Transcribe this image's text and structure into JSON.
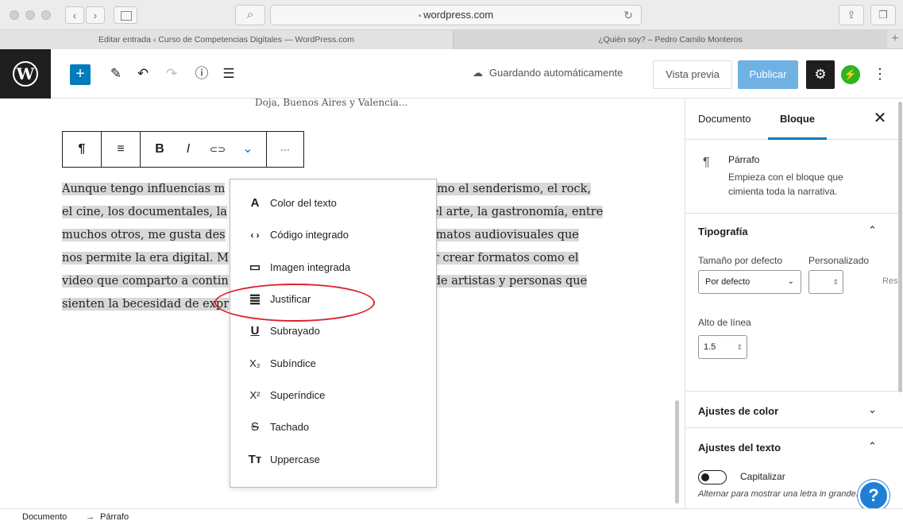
{
  "browser": {
    "url": "wordpress.com",
    "lock_icon": "lock-icon",
    "tabs": [
      {
        "title": "Editar entrada ‹ Curso de Competencias Digitales — WordPress.com",
        "active": true
      },
      {
        "title": "¿Quién soy? – Pedro Camilo Monteros",
        "active": false
      }
    ],
    "back_label": "‹",
    "forward_label": "›",
    "new_tab_label": "+"
  },
  "header": {
    "logo": "W",
    "add_block_label": "+",
    "saving_text": "Guardando automáticamente",
    "preview_label": "Vista previa",
    "publish_label": "Publicar",
    "more_label": "⋮"
  },
  "editor": {
    "cut_text": "Doja, Buenos Aires y Valencia...",
    "toolbar": {
      "paragraph": "¶",
      "align": "≡",
      "bold": "B",
      "italic": "I",
      "link": "⊂⊃",
      "more_formats": "⌄",
      "options": "···"
    },
    "paragraph_lines": [
      {
        "left": "Aunque tengo influencias m",
        "right": "omo el senderismo,  el rock,"
      },
      {
        "left": "el cine, los documentales, la",
        "right": "el arte, la gastronomía, entre"
      },
      {
        "left": "muchos otros, me gusta des",
        "right": "rmatos audiovisuales que"
      },
      {
        "left": "nos permite la era digital. M",
        "right": "r crear formatos como el"
      },
      {
        "left": "video que comparto a contin",
        "right": "de artistas y personas que"
      },
      {
        "left": "sienten la becesidad de expr",
        "right": ""
      }
    ]
  },
  "format_menu": {
    "items": [
      {
        "icon": "A",
        "label": "Color del texto"
      },
      {
        "icon": "‹ ›",
        "label": "Código integrado"
      },
      {
        "icon": "▭",
        "label": "Imagen integrada"
      },
      {
        "icon": "≣",
        "label": "Justificar"
      },
      {
        "icon": "U",
        "label": "Subrayado"
      },
      {
        "icon": "X₂",
        "label": "Subíndice"
      },
      {
        "icon": "X²",
        "label": "Superíndice"
      },
      {
        "icon": "S",
        "label": "Tachado"
      },
      {
        "icon": "Tт",
        "label": "Uppercase"
      }
    ],
    "highlight_color": "#e0202d"
  },
  "sidebar": {
    "tabs": [
      "Documento",
      "Bloque"
    ],
    "active_tab": "Bloque",
    "close_label": "✕",
    "block": {
      "icon": "¶",
      "title": "Párrafo",
      "description": "Empieza con el bloque que cimienta toda la narrativa."
    },
    "typography": {
      "title": "Tipografía",
      "size_label": "Tamaño por defecto",
      "custom_label": "Personalizado",
      "size_value": "Por defecto",
      "reset_label": "Res",
      "line_height_label": "Alto de línea",
      "line_height_value": "1.5"
    },
    "color_settings": "Ajustes de color",
    "text_settings": "Ajustes del texto",
    "toggle_label": "Capitalizar",
    "help_note": "Alternar para mostrar una letra in grande."
  },
  "footer": {
    "crumb1": "Documento",
    "arrow": "→",
    "crumb2": "Párrafo"
  },
  "colors": {
    "accent": "#007cba",
    "publish": "#6fb1e3",
    "jetpack": "#2fb41f",
    "help": "#1f7fd6"
  }
}
